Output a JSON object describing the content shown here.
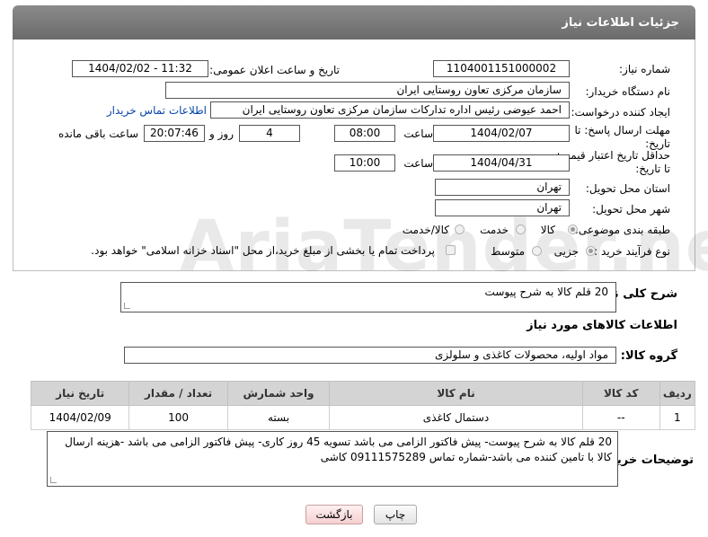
{
  "header": {
    "title": "جزئیات اطلاعات نیاز"
  },
  "form": {
    "need_number_label": "شماره نیاز:",
    "need_number": "1104001151000002",
    "announce_label": "تاریخ و ساعت اعلان عمومی:",
    "announce_value": "1404/02/02 - 11:32",
    "buyer_org_label": "نام دستگاه خریدار:",
    "buyer_org": "سازمان مرکزی تعاون روستایی ایران",
    "creator_label": "ایجاد کننده درخواست:",
    "creator": "احمد عیوضی رئیس اداره تدارکات سازمان مرکزی تعاون روستایی ایران",
    "contact_link": "اطلاعات تماس خریدار",
    "deadline_label_1": "مهلت ارسال پاسخ: تا",
    "deadline_label_2": "تاریخ:",
    "deadline_date": "1404/02/07",
    "time_label": "ساعت",
    "deadline_time": "08:00",
    "days_value": "4",
    "days_label": "روز و",
    "remaining_time": "20:07:46",
    "remaining_label": "ساعت باقی مانده",
    "validity_label_1": "حداقل تاریخ اعتبار قیمت:",
    "validity_label_2": "تا تاریخ:",
    "validity_date": "1404/04/31",
    "validity_time_label": "ساعت",
    "validity_time": "10:00",
    "province_label": "استان محل تحویل:",
    "province": "تهران",
    "city_label": "شهر محل تحویل:",
    "city": "تهران",
    "category_label": "طبقه بندی موضوعی:",
    "category_options": [
      "کالا",
      "خدمت",
      "کالا/خدمت"
    ],
    "category_selected": "کالا",
    "process_label": "نوع فرآیند خرید :",
    "process_options": [
      "جزیی",
      "متوسط"
    ],
    "process_selected": "جزیی",
    "payment_note": "پرداخت تمام یا بخشی از مبلغ خرید،از محل \"اسناد خزانه اسلامی\" خواهد بود."
  },
  "description": {
    "label": "شرح کلی نیاز:",
    "value": "20 قلم کالا به شرح پیوست"
  },
  "goods_info": {
    "title": "اطلاعات کالاهای مورد نیاز",
    "group_label": "گروه کالا:",
    "group_value": "مواد اولیه، محصولات کاغذی و سلولزی"
  },
  "table": {
    "headers": [
      "ردیف",
      "کد کالا",
      "نام کالا",
      "واحد شمارش",
      "تعداد / مقدار",
      "تاریخ نیاز"
    ],
    "rows": [
      [
        "1",
        "--",
        "دستمال کاغذی",
        "بسته",
        "100",
        "1404/02/09"
      ]
    ]
  },
  "buyer_notes": {
    "label": "توضیحات خریدار:",
    "value": "20 قلم کالا به شرح پیوست- پیش فاکتور الزامی می باشد تسویه 45 روز کاری- پیش فاکتور الزامی می باشد -هزینه ارسال کالا با تامین کننده می باشد-شماره تماس 09111575289 کاشی"
  },
  "buttons": {
    "print": "چاپ",
    "back": "بازگشت"
  },
  "watermark": {
    "text": "AriaTender.neT"
  }
}
